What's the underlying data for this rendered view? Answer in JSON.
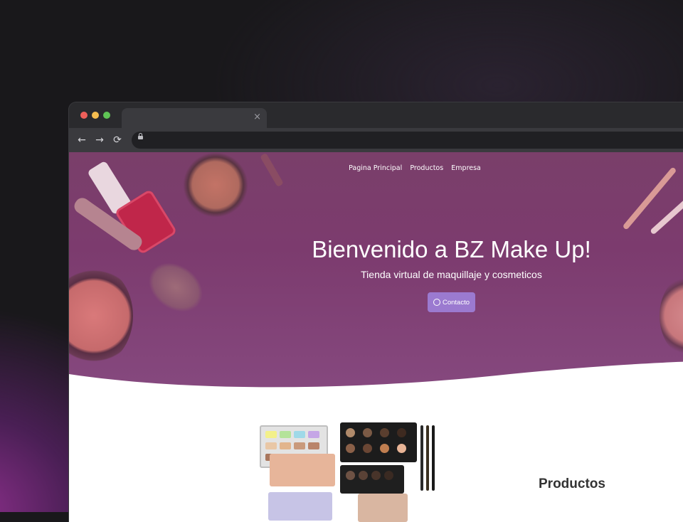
{
  "browser": {
    "tab_title": "",
    "tab_close_icon": "×",
    "back_icon": "←",
    "forward_icon": "→",
    "reload_icon": "⟳",
    "address": ""
  },
  "nav": {
    "items": [
      {
        "label": "Pagina Principal"
      },
      {
        "label": "Productos"
      },
      {
        "label": "Empresa"
      }
    ]
  },
  "hero": {
    "title": "Bienvenido a BZ Make Up!",
    "subtitle": "Tienda virtual de maquillaje y cosmeticos",
    "contact_label": "Contacto",
    "contact_icon": "whatsapp-icon"
  },
  "products": {
    "title": "Productos"
  },
  "colors": {
    "hero": "#7c3b6e",
    "button": "#9b7ad0",
    "window": "#2b2b2e"
  }
}
